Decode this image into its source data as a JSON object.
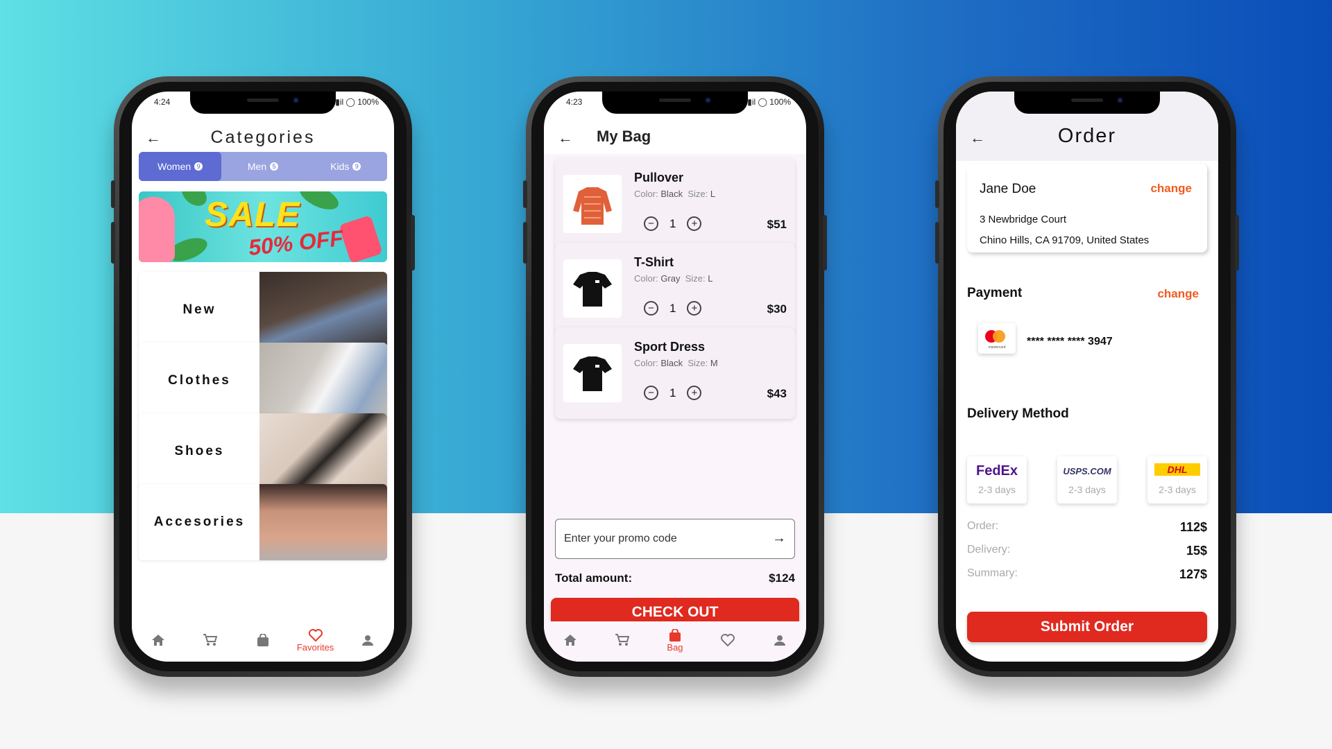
{
  "colors": {
    "accent_red": "#e0291f",
    "change_orange": "#f25a1f",
    "segment_active": "#5d6bd3",
    "segment_bg": "#9aa4e0"
  },
  "phone1": {
    "time": "4:24",
    "battery": "100%",
    "title": "Categories",
    "tabs": [
      {
        "label": "Women",
        "count": "9"
      },
      {
        "label": "Men",
        "count": "5"
      },
      {
        "label": "Kids",
        "count": "9"
      }
    ],
    "banner": {
      "sale": "SALE",
      "off": "50% OFF"
    },
    "categories": [
      "New",
      "Clothes",
      "Shoes",
      "Accesories"
    ],
    "nav": {
      "active_label": "Favorites",
      "icons": [
        "home-icon",
        "cart-icon",
        "bag-icon",
        "heart-icon",
        "person-icon"
      ]
    }
  },
  "phone2": {
    "time": "4:23",
    "battery": "100%",
    "title": "My Bag",
    "items": [
      {
        "name": "Pullover",
        "color_label": "Color:",
        "color": "Black",
        "size_label": "Size:",
        "size": "L",
        "qty": "1",
        "price": "$51"
      },
      {
        "name": "T-Shirt",
        "color_label": "Color:",
        "color": "Gray",
        "size_label": "Size:",
        "size": "L",
        "qty": "1",
        "price": "$30"
      },
      {
        "name": "Sport Dress",
        "color_label": "Color:",
        "color": "Black",
        "size_label": "Size:",
        "size": "M",
        "qty": "1",
        "price": "$43"
      }
    ],
    "promo_placeholder": "Enter your promo code",
    "total_label": "Total amount:",
    "total_value": "$124",
    "checkout_label": "CHECK OUT",
    "nav": {
      "active_label": "Bag"
    }
  },
  "phone3": {
    "title": "Order",
    "address": {
      "name": "Jane Doe",
      "change": "change",
      "line1": "3 Newbridge Court",
      "line2": "Chino Hills, CA 91709, United States"
    },
    "payment": {
      "title": "Payment",
      "change": "change",
      "card_brand": "mastercard",
      "card_number": "**** **** **** 3947"
    },
    "delivery": {
      "title": "Delivery Method",
      "options": [
        {
          "carrier": "FedEx",
          "days": "2-3 days"
        },
        {
          "carrier": "USPS.COM",
          "days": "2-3 days"
        },
        {
          "carrier": "DHL",
          "days": "2-3 days"
        }
      ]
    },
    "summary": [
      {
        "label": "Order:",
        "value": "112$"
      },
      {
        "label": "Delivery:",
        "value": "15$"
      },
      {
        "label": "Summary:",
        "value": "127$"
      }
    ],
    "submit_label": "Submit Order"
  }
}
